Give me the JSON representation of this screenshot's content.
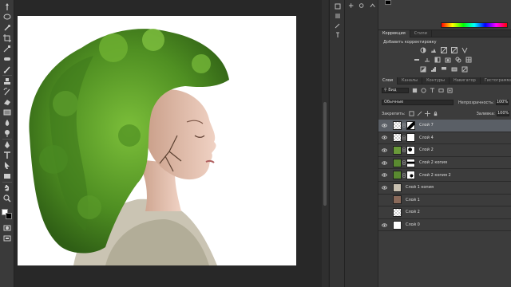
{
  "canvas": {
    "background": "#ffffff"
  },
  "panels": {
    "color": {
      "foreground": "#000000"
    },
    "adjustments": {
      "tabs": [
        "Коррекция",
        "Стили"
      ],
      "title": "Добавить корректировку"
    },
    "layers": {
      "tabs": [
        "Слои",
        "Каналы",
        "Контуры",
        "Навигатор",
        "Гистограмма"
      ],
      "filter_kind": "Вид",
      "blend_mode": "Обычные",
      "opacity_label": "Непрозрачность:",
      "opacity_value": "100%",
      "lock_label": "Закрепить:",
      "fill_label": "Заливка:",
      "fill_value": "100%",
      "items": [
        {
          "name": "Слой 7",
          "selected": true
        },
        {
          "name": "Слой 4",
          "selected": false
        },
        {
          "name": "Слой 2",
          "selected": false
        },
        {
          "name": "Слой 2 копия",
          "selected": false
        },
        {
          "name": "Слой 2 копия 2",
          "selected": false
        },
        {
          "name": "Слой 1 копия",
          "selected": false
        },
        {
          "name": "Слой 1",
          "selected": false
        },
        {
          "name": "Слой 2",
          "selected": false
        },
        {
          "name": "Слой 0",
          "selected": false
        }
      ]
    }
  },
  "colors": {
    "ui_dark": "#2b2b2b",
    "panel": "#3c3c3c",
    "selected_layer": "#5a5f66",
    "foliage": "#5a9a2a"
  }
}
